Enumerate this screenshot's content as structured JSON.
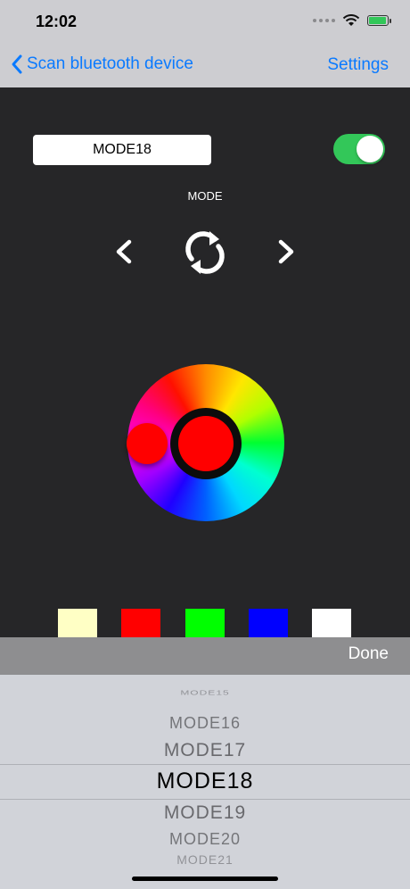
{
  "status": {
    "time": "12:02"
  },
  "nav": {
    "back_label": "Scan bluetooth device",
    "settings_label": "Settings"
  },
  "controls": {
    "mode_value": "MODE18",
    "mode_label": "MODE",
    "toggle_on": true
  },
  "color_wheel": {
    "selected_color": "#ff0000"
  },
  "swatches": [
    "#ffffc5",
    "#ff0000",
    "#00ff00",
    "#0000ff",
    "#ffffff"
  ],
  "toolbar": {
    "done_label": "Done"
  },
  "picker": {
    "items": [
      "MODE15",
      "MODE16",
      "MODE17",
      "MODE18",
      "MODE19",
      "MODE20",
      "MODE21"
    ],
    "selected": "MODE18"
  },
  "colors": {
    "accent": "#0a7aff",
    "toggle_on": "#33c759",
    "background": "#262628"
  }
}
